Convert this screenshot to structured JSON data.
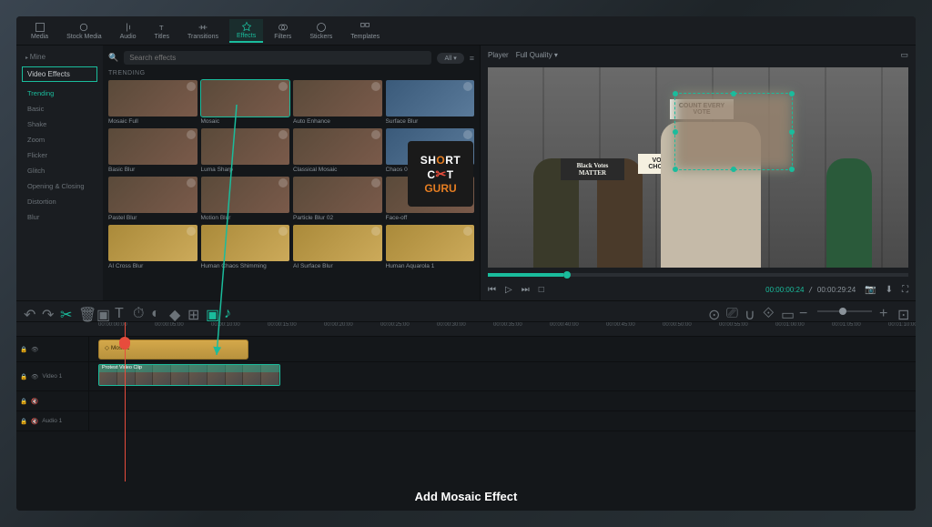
{
  "toolbar_tabs": [
    "Media",
    "Stock Media",
    "Audio",
    "Titles",
    "Transitions",
    "Effects",
    "Filters",
    "Stickers",
    "Templates"
  ],
  "toolbar_active_index": 5,
  "sidebar": {
    "mine_label": "Mine",
    "video_effects_label": "Video Effects",
    "items": [
      "Trending",
      "Basic",
      "Shake",
      "Zoom",
      "Flicker",
      "Glitch",
      "Opening & Closing",
      "Distortion",
      "Blur"
    ],
    "active_index": 0
  },
  "search": {
    "placeholder": "Search effects",
    "filter_label": "All"
  },
  "grid_section": "TRENDING",
  "effects": [
    {
      "label": "Mosaic Full",
      "style": ""
    },
    {
      "label": "Mosaic",
      "style": "selected"
    },
    {
      "label": "Auto Enhance",
      "style": ""
    },
    {
      "label": "Surface Blur",
      "style": "blue"
    },
    {
      "label": "Basic Blur",
      "style": ""
    },
    {
      "label": "Luma Sharp",
      "style": ""
    },
    {
      "label": "Classical Mosaic",
      "style": ""
    },
    {
      "label": "Chaos 02",
      "style": "blue"
    },
    {
      "label": "Pastel Blur",
      "style": ""
    },
    {
      "label": "Motion Blur",
      "style": ""
    },
    {
      "label": "Particle Blur 02",
      "style": ""
    },
    {
      "label": "Face-off",
      "style": ""
    },
    {
      "label": "AI Cross Blur",
      "style": "yellow"
    },
    {
      "label": "Human Chaos Shimming",
      "style": "yellow"
    },
    {
      "label": "AI Surface Blur",
      "style": "yellow"
    },
    {
      "label": "Human Aquarola 1",
      "style": "yellow"
    }
  ],
  "player": {
    "title": "Player",
    "quality": "Full Quality",
    "time_current": "00:00:00:24",
    "time_total": "00:00:29:24",
    "signs": {
      "s1": "COUNT EVERY VOTE",
      "s2": "Black Votes MATTER",
      "s3": "VOTE CHOICE"
    }
  },
  "ruler_marks": [
    "00:00:00:00",
    "00:00:05:00",
    "00:00:10:00",
    "00:00:15:00",
    "00:00:20:00",
    "00:00:25:00",
    "00:00:30:00",
    "00:00:35:00",
    "00:00:40:00",
    "00:00:45:00",
    "00:00:50:00",
    "00:00:55:00",
    "00:01:00:00",
    "00:01:05:00",
    "00:01:10:00"
  ],
  "timeline": {
    "effect_clip_label": "Mosaic",
    "video_clip_label": "Protest Video Clip"
  },
  "tracks": {
    "t1_label": "",
    "video1_label": "Video 1",
    "t3_label": "",
    "audio1_label": "Audio 1"
  },
  "caption": "Add Mosaic Effect",
  "logo": {
    "line1_a": "SH",
    "line1_b": "RT",
    "cut": "C✂T",
    "guru": "GURU"
  },
  "colors": {
    "accent": "#1abc9c",
    "playhead": "#e74c3c",
    "effect_clip": "#d4a84a"
  }
}
